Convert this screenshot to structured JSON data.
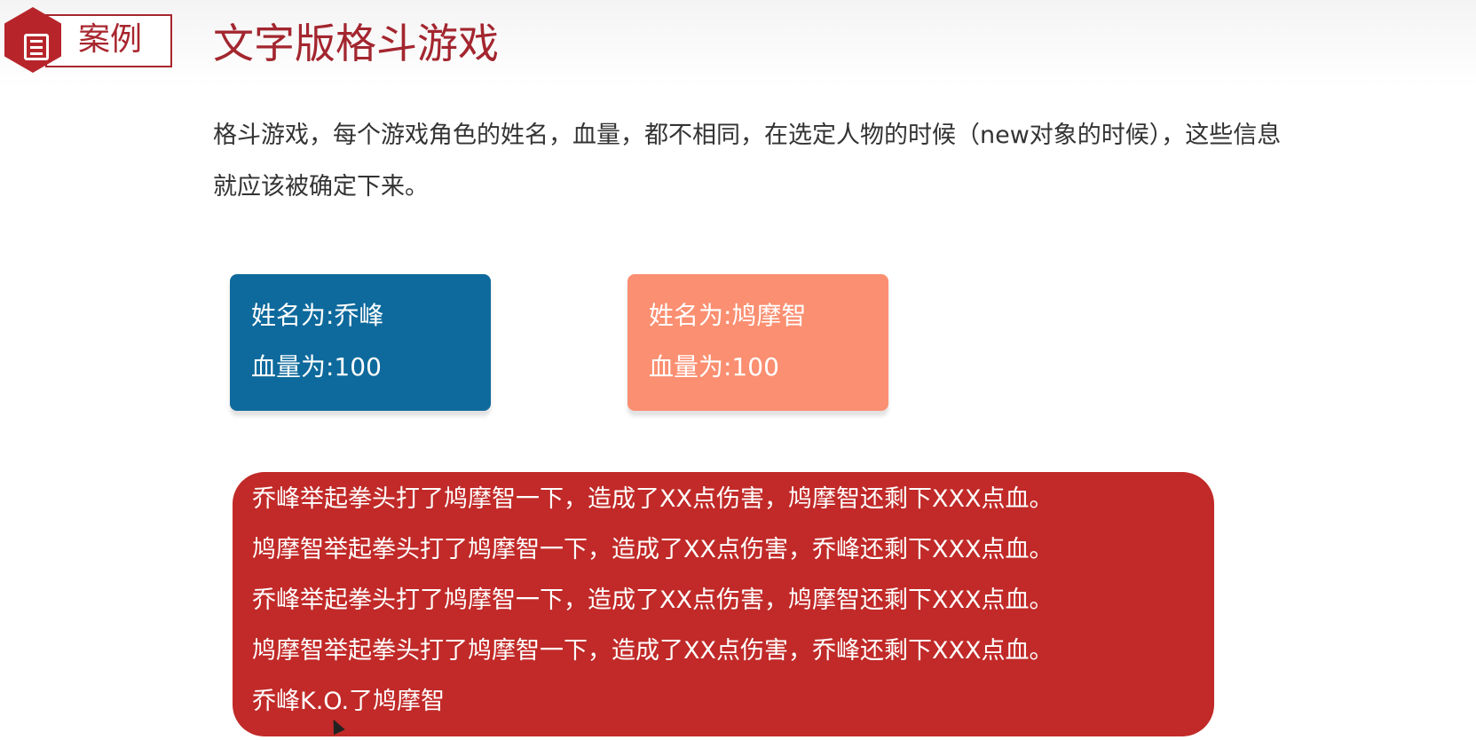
{
  "header": {
    "badge_label": "案例",
    "title": "文字版格斗游戏",
    "badge_icon": "document-icon"
  },
  "description": {
    "line1": "格斗游戏，每个游戏角色的姓名，血量，都不相同，在选定人物的时候（new对象的时候），这些信息",
    "line2": "就应该被确定下来。"
  },
  "cards": [
    {
      "name": "姓名为:乔峰",
      "hp": "血量为:100",
      "color": "#0e6a9c"
    },
    {
      "name": "姓名为:鸠摩智",
      "hp": "血量为:100",
      "color": "#fb8f71"
    }
  ],
  "log": {
    "color": "#c12a28",
    "lines": [
      "乔峰举起拳头打了鸠摩智一下，造成了XX点伤害，鸠摩智还剩下XXX点血。",
      "鸠摩智举起拳头打了鸠摩智一下，造成了XX点伤害，乔峰还剩下XXX点血。",
      "乔峰举起拳头打了鸠摩智一下，造成了XX点伤害，鸠摩智还剩下XXX点血。",
      "鸠摩智举起拳头打了鸠摩智一下，造成了XX点伤害，乔峰还剩下XXX点血。",
      "乔峰K.O.了鸠摩智"
    ]
  }
}
